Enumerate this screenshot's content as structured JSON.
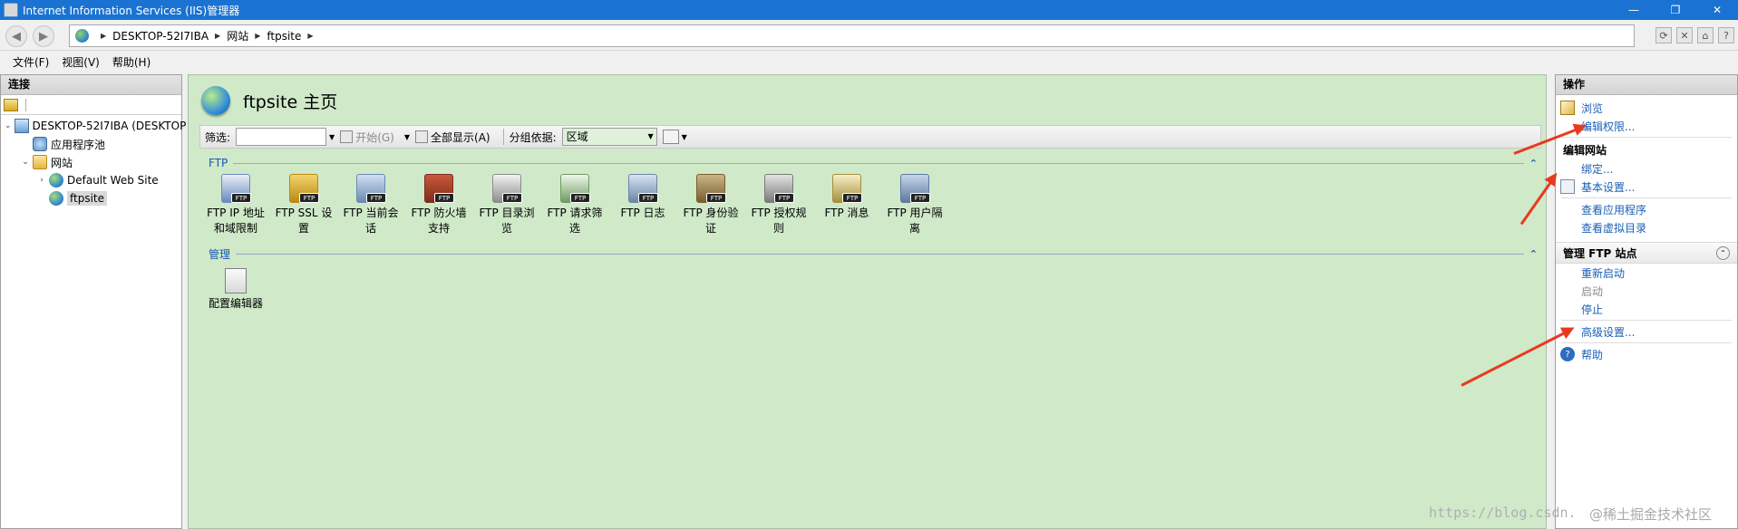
{
  "window": {
    "title": "Internet Information Services (IIS)管理器",
    "controls": {
      "minimize": "—",
      "restore": "❐",
      "close": "✕"
    }
  },
  "address": {
    "back_icon": "back-arrow-icon",
    "forward_icon": "forward-arrow-icon",
    "crumbs": [
      "DESKTOP-52I7IBA",
      "网站",
      "ftpsite"
    ]
  },
  "menu": {
    "items": [
      "文件(F)",
      "视图(V)",
      "帮助(H)"
    ]
  },
  "connections": {
    "title": "连接",
    "tree": {
      "server": "DESKTOP-52I7IBA (DESKTOP",
      "app_pools": "应用程序池",
      "sites": "网站",
      "default_site": "Default Web Site",
      "ftpsite": "ftpsite"
    }
  },
  "main": {
    "page_title": "ftpsite 主页",
    "filter": {
      "label": "筛选:",
      "value": "",
      "start": "开始(G)",
      "show_all": "全部显示(A)",
      "group_label": "分组依据:",
      "group_value": "区域"
    },
    "sections": [
      {
        "label": "FTP",
        "features": [
          {
            "line1": "FTP IP 地址",
            "line2": "和域限制"
          },
          {
            "line1": "FTP SSL 设",
            "line2": "置"
          },
          {
            "line1": "FTP 当前会",
            "line2": "话"
          },
          {
            "line1": "FTP 防火墙",
            "line2": "支持"
          },
          {
            "line1": "FTP 目录浏",
            "line2": "览"
          },
          {
            "line1": "FTP 请求筛",
            "line2": "选"
          },
          {
            "line1": "FTP 日志",
            "line2": ""
          },
          {
            "line1": "FTP 身份验",
            "line2": "证"
          },
          {
            "line1": "FTP 授权规",
            "line2": "则"
          },
          {
            "line1": "FTP 消息",
            "line2": ""
          },
          {
            "line1": "FTP 用户隔",
            "line2": "离"
          }
        ]
      },
      {
        "label": "管理",
        "features": [
          {
            "line1": "配置编辑器",
            "line2": ""
          }
        ]
      }
    ],
    "ftp_badge": "FTP"
  },
  "actions": {
    "title": "操作",
    "browse": "浏览",
    "edit_perms": "编辑权限...",
    "edit_site_head": "编辑网站",
    "bindings": "绑定...",
    "basic_settings": "基本设置...",
    "view_apps": "查看应用程序",
    "view_vdirs": "查看虚拟目录",
    "manage_head": "管理 FTP 站点",
    "restart": "重新启动",
    "start": "启动",
    "stop": "停止",
    "advanced": "高级设置...",
    "help": "帮助"
  },
  "watermark": {
    "url": "https://blog.csdn.",
    "brand": "@稀土掘金技术社区"
  },
  "colors": {
    "titlebar": "#1a73d2",
    "center_bg": "#cfe9c9",
    "link": "#1a5fb4",
    "arrow": "#e83a1e"
  }
}
